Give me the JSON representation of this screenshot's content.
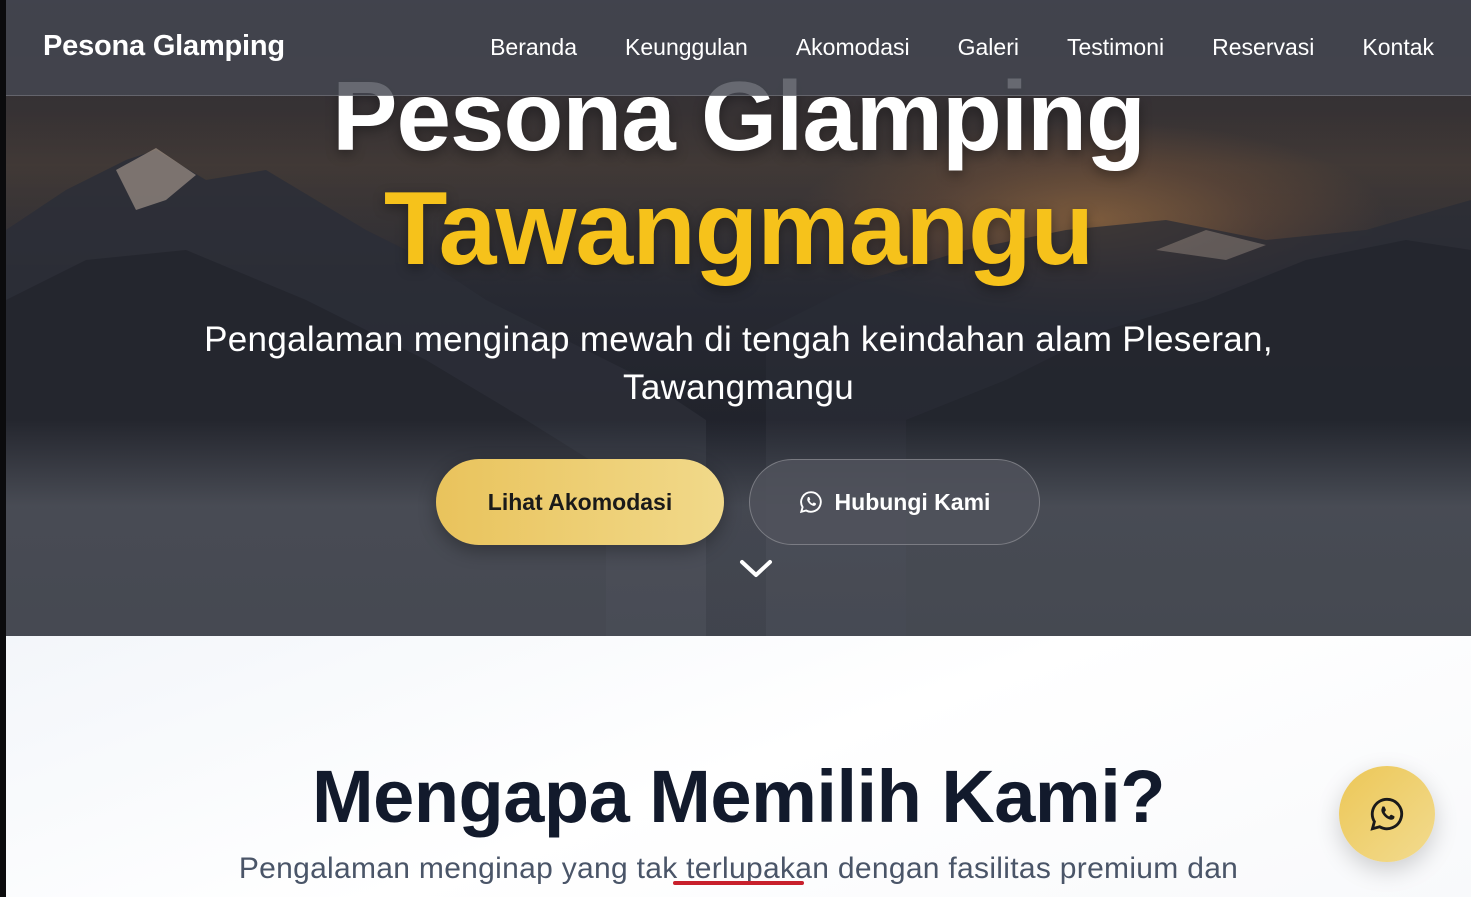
{
  "navbar": {
    "brand": "Pesona Glamping",
    "links": [
      "Beranda",
      "Keunggulan",
      "Akomodasi",
      "Galeri",
      "Testimoni",
      "Reservasi",
      "Kontak"
    ]
  },
  "hero": {
    "title_line1": "Pesona Glamping",
    "title_line2": "Tawangmangu",
    "subtitle": "Pengalaman menginap mewah di tengah keindahan alam Pleseran, Tawangmangu",
    "primary_button": "Lihat Akomodasi",
    "secondary_button": "Hubungi Kami"
  },
  "features": {
    "title": "Mengapa Memilih Kami?",
    "subtitle": "Pengalaman menginap yang tak terlupakan dengan fasilitas premium dan"
  },
  "icons": {
    "whatsapp": "whatsapp-icon",
    "scroll_down": "chevron-down-icon"
  },
  "colors": {
    "accent_gold": "#f6c21b",
    "button_gold": "#ecc757",
    "dark_text": "#121a2c"
  }
}
